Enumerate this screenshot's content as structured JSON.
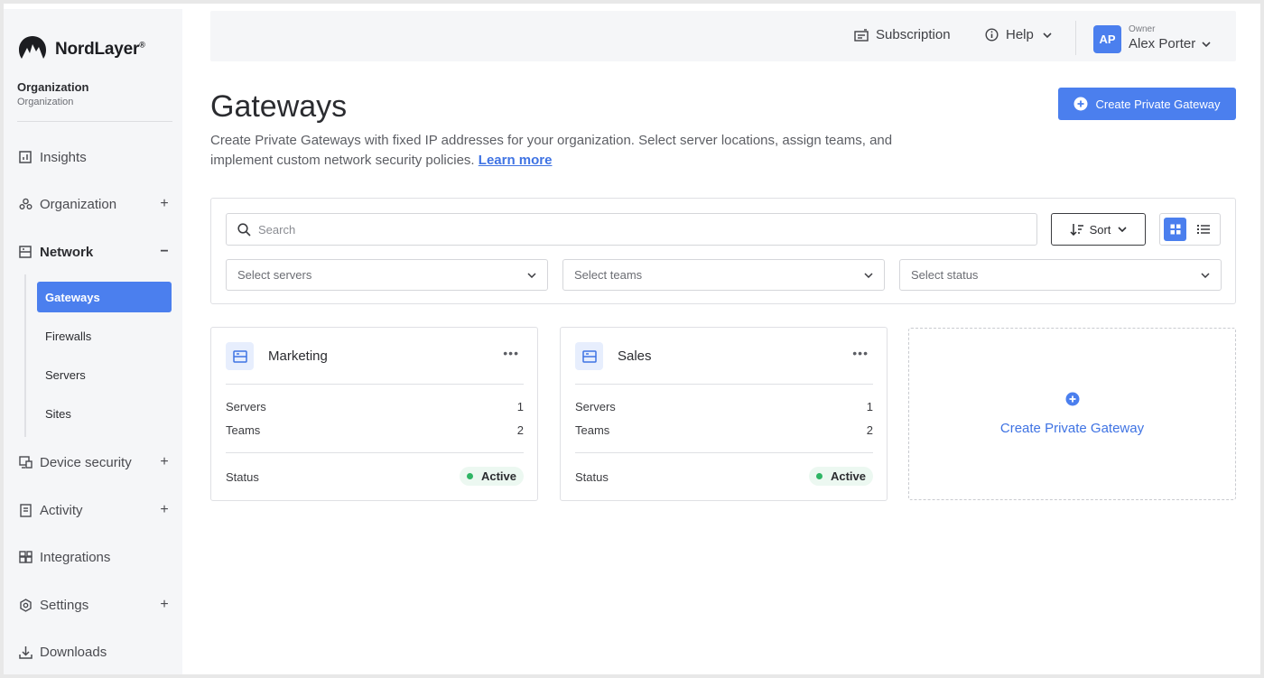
{
  "brand": {
    "name": "NordLayer",
    "mark": "®"
  },
  "org": {
    "title": "Organization",
    "subtitle": "Organization"
  },
  "sidebar": {
    "items": [
      {
        "label": "Insights",
        "toggle": ""
      },
      {
        "label": "Organization",
        "toggle": "+"
      },
      {
        "label": "Network",
        "toggle": "−"
      },
      {
        "label": "Device security",
        "toggle": "+"
      },
      {
        "label": "Activity",
        "toggle": "+"
      },
      {
        "label": "Integrations",
        "toggle": ""
      },
      {
        "label": "Settings",
        "toggle": "+"
      },
      {
        "label": "Downloads",
        "toggle": ""
      }
    ],
    "network_subitems": [
      {
        "label": "Gateways"
      },
      {
        "label": "Firewalls"
      },
      {
        "label": "Servers"
      },
      {
        "label": "Sites"
      }
    ]
  },
  "header": {
    "subscription": "Subscription",
    "help": "Help",
    "user": {
      "initials": "AP",
      "role": "Owner",
      "name": "Alex Porter"
    }
  },
  "page": {
    "title": "Gateways",
    "description": "Create Private Gateways with fixed IP addresses for your organization. Select server locations, assign teams, and implement custom network security policies.",
    "learn_more": "Learn more",
    "create_button": "Create Private Gateway"
  },
  "filters": {
    "search_placeholder": "Search",
    "sort_label": "Sort",
    "servers_placeholder": "Select servers",
    "teams_placeholder": "Select teams",
    "status_placeholder": "Select status"
  },
  "gateways": [
    {
      "name": "Marketing",
      "servers_label": "Servers",
      "servers": "1",
      "teams_label": "Teams",
      "teams": "2",
      "status_label": "Status",
      "status": "Active"
    },
    {
      "name": "Sales",
      "servers_label": "Servers",
      "servers": "1",
      "teams_label": "Teams",
      "teams": "2",
      "status_label": "Status",
      "status": "Active"
    }
  ],
  "create_card": {
    "label": "Create Private Gateway"
  },
  "colors": {
    "accent": "#4b7fee",
    "link": "#3f73e3",
    "active_status": "#2fb565"
  }
}
